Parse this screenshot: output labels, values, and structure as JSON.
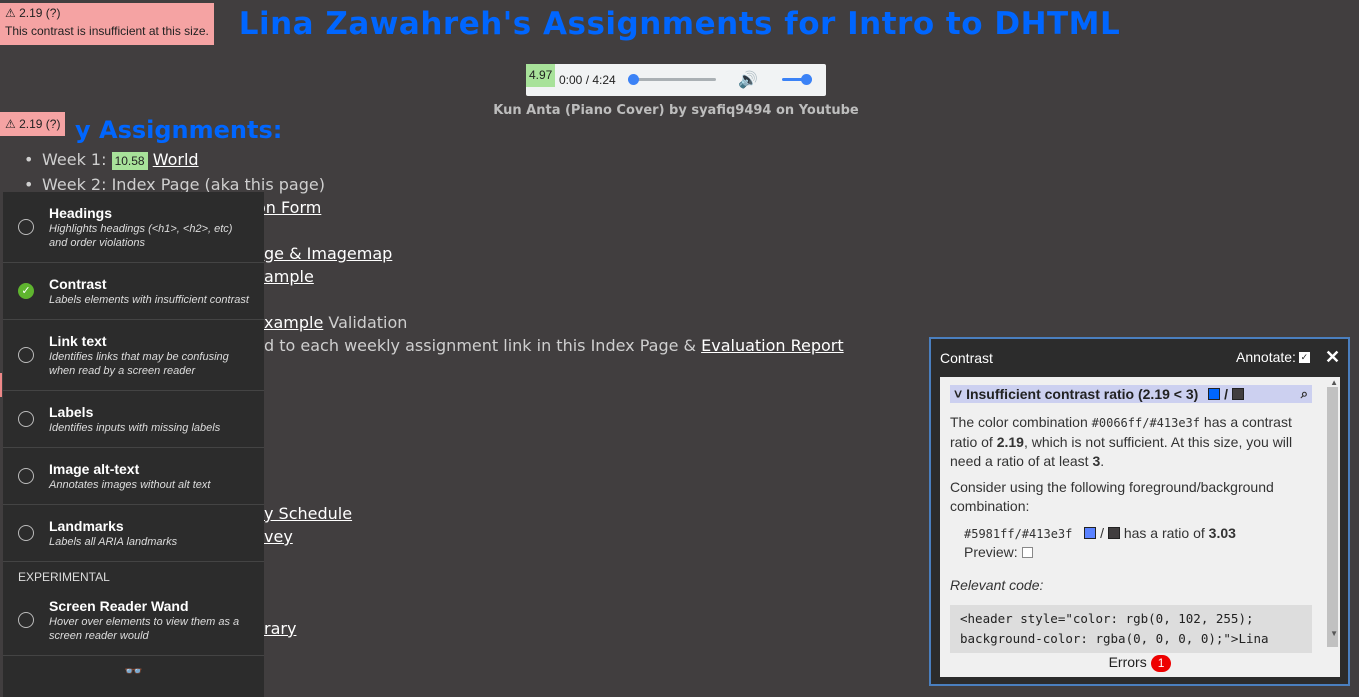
{
  "page": {
    "title": "Lina Zawahreh's Assignments for Intro to DHTML",
    "audio_caption": "Kun Anta (Piano Cover) by syafiq9494 on Youtube",
    "section_heading": "My Assignments:",
    "section_heading_visible": "y Assignments:"
  },
  "audio": {
    "badge": "4.97",
    "time": "0:00 / 4:24",
    "progress_fraction": 0.0,
    "volume_fraction": 1.0
  },
  "badges": {
    "top_ratio": "⚠ 2.19  (?)",
    "top_msg": "This contrast is insufficient at this size.",
    "mid_ratio": "⚠ 2.19  (?)",
    "week1_ratio": "10.58"
  },
  "list": {
    "week1_prefix": "Week 1: ",
    "week1_link": "World",
    "week2": "Week 2: Index Page (aka this page)",
    "frag_form": "on Form",
    "frag_imagemap": "ge & Imagemap",
    "frag_ample": "ample",
    "frag_xample_link": "xample",
    "frag_validation": " Validation",
    "frag_added": "d to each weekly assignment link in this Index Page & ",
    "frag_eval_link": "Evaluation Report",
    "frag_schedule": "y Schedule",
    "frag_vey": "vey",
    "frag_rary": "rary"
  },
  "tools": {
    "items": [
      {
        "title": "Headings",
        "desc": "Highlights headings (<h1>, <h2>, etc) and order violations",
        "checked": false
      },
      {
        "title": "Contrast",
        "desc": "Labels elements with insufficient contrast",
        "checked": true
      },
      {
        "title": "Link text",
        "desc": "Identifies links that may be confusing when read by a screen reader",
        "checked": false
      },
      {
        "title": "Labels",
        "desc": "Identifies inputs with missing labels",
        "checked": false
      },
      {
        "title": "Image alt-text",
        "desc": "Annotates images without alt text",
        "checked": false
      },
      {
        "title": "Landmarks",
        "desc": "Labels all ARIA landmarks",
        "checked": false
      }
    ],
    "experimental_label": "EXPERIMENTAL",
    "wand": {
      "title": "Screen Reader Wand",
      "desc": "Hover over elements to view them as a screen reader would",
      "checked": false
    },
    "footer_icon": "glasses-icon"
  },
  "contrast_panel": {
    "title": "Contrast",
    "annotate_label": "Annotate:",
    "annotate_checked": true,
    "header": "Insufficient contrast ratio (2.19 < 3)",
    "p1_a": "The color combination ",
    "p1_code": "#0066ff/#413e3f",
    "p1_b": " has a contrast ratio of ",
    "p1_ratio": "2.19",
    "p1_c": ", which is not sufficient. At this size, you will need a ratio of at least ",
    "p1_min": "3",
    "p1_d": ".",
    "p2": "Consider using the following foreground/background combination:",
    "suggest_code": "#5981ff/#413e3f",
    "suggest_text": " has a ratio of ",
    "suggest_ratio": "3.03",
    "preview_label": "Preview:",
    "relevant_label": "Relevant code:",
    "code_line1": "<header style=\"color: rgb(0, 102, 255);",
    "code_line2": "background-color: rgba(0, 0, 0, 0);\">Lina",
    "errors_label": "Errors",
    "errors_count": "1",
    "colors": {
      "fg": "#0066ff",
      "bg": "#413e3f",
      "suggest_fg": "#5981ff"
    }
  }
}
